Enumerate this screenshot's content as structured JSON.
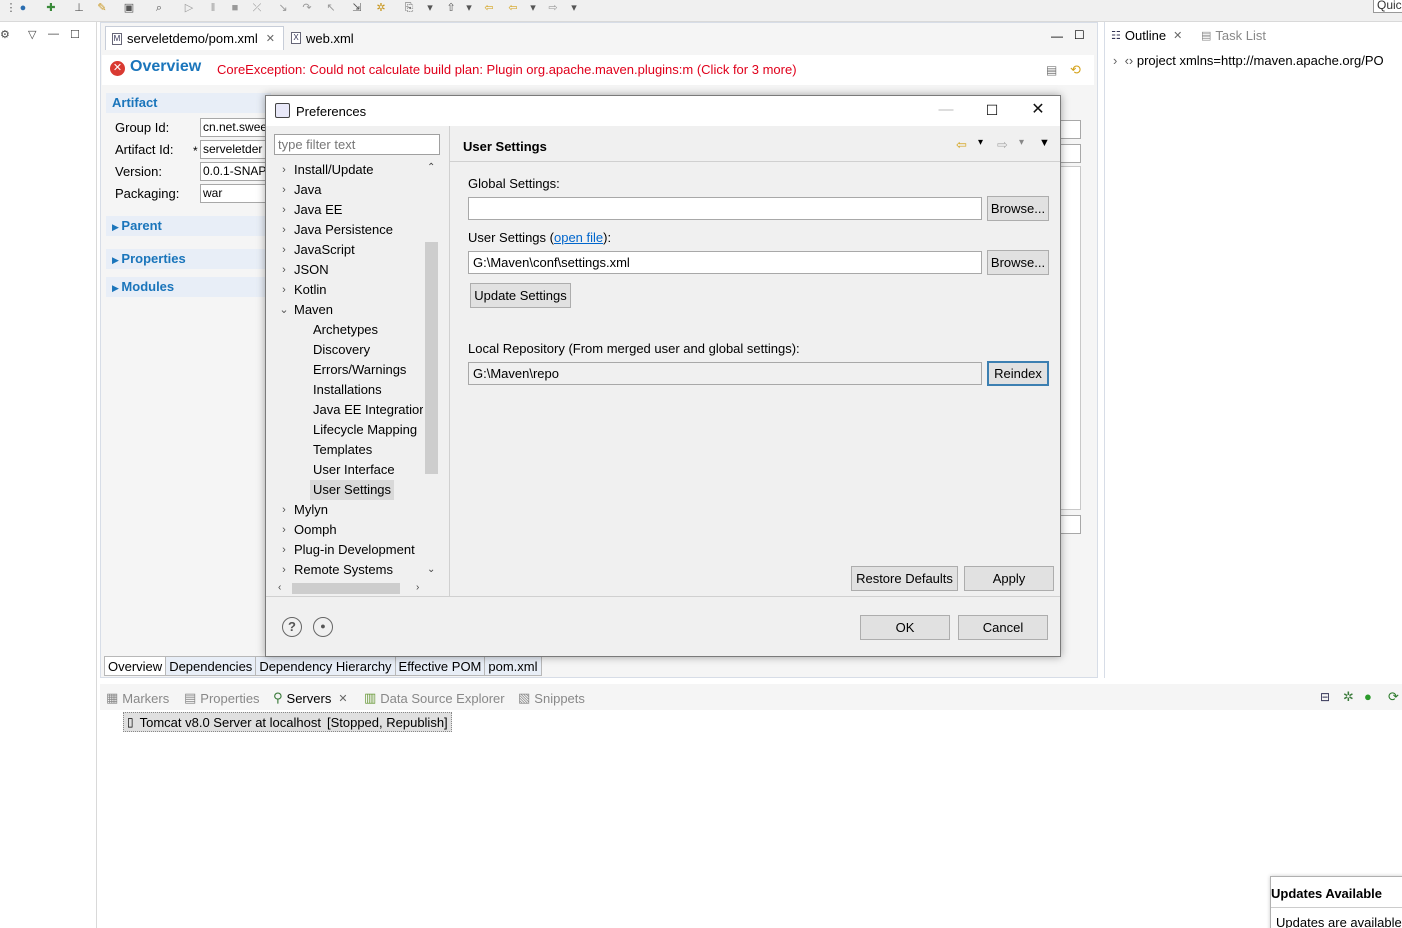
{
  "toolbar": {
    "quick_access": "Quic"
  },
  "editor": {
    "tabs": [
      {
        "label": "serveletdemo/pom.xml",
        "icon": "M"
      },
      {
        "label": "web.xml",
        "icon": "X"
      }
    ],
    "overview": {
      "title": "Overview",
      "error": "CoreException: Could not calculate build plan: Plugin org.apache.maven.plugins:m (Click for 3 more)"
    },
    "artifact": {
      "heading": "Artifact",
      "group_id_label": "Group Id:",
      "group_id": "cn.net.swee",
      "artifact_id_label": "Artifact Id:",
      "artifact_marker": "*",
      "artifact_id": "serveletder",
      "version_label": "Version:",
      "version": "0.0.1-SNAP",
      "packaging_label": "Packaging:",
      "packaging": "war"
    },
    "sections": [
      "Parent",
      "Properties",
      "Modules"
    ],
    "bottom_tabs": [
      "Overview",
      "Dependencies",
      "Dependency Hierarchy",
      "Effective POM",
      "pom.xml"
    ]
  },
  "outline": {
    "tabs": [
      "Outline",
      "Task List"
    ],
    "node": "project xmlns=http://maven.apache.org/PO"
  },
  "servers_panel": {
    "tabs": [
      "Markers",
      "Properties",
      "Servers",
      "Data Source Explorer",
      "Snippets"
    ],
    "server": "Tomcat v8.0 Server at localhost",
    "server_state": "[Stopped, Republish]"
  },
  "updates": {
    "title": "Updates Available",
    "body": "Updates are available"
  },
  "dialog": {
    "title": "Preferences",
    "filter_placeholder": "type filter text",
    "tree": [
      {
        "label": "Install/Update",
        "arrow": "›",
        "level": 0
      },
      {
        "label": "Java",
        "arrow": "›",
        "level": 0
      },
      {
        "label": "Java EE",
        "arrow": "›",
        "level": 0
      },
      {
        "label": "Java Persistence",
        "arrow": "›",
        "level": 0
      },
      {
        "label": "JavaScript",
        "arrow": "›",
        "level": 0
      },
      {
        "label": "JSON",
        "arrow": "›",
        "level": 0
      },
      {
        "label": "Kotlin",
        "arrow": "›",
        "level": 0
      },
      {
        "label": "Maven",
        "arrow": "⌄",
        "level": 0
      },
      {
        "label": "Archetypes",
        "arrow": "",
        "level": 1
      },
      {
        "label": "Discovery",
        "arrow": "",
        "level": 1
      },
      {
        "label": "Errors/Warnings",
        "arrow": "",
        "level": 1
      },
      {
        "label": "Installations",
        "arrow": "",
        "level": 1
      },
      {
        "label": "Java EE Integratior",
        "arrow": "",
        "level": 1
      },
      {
        "label": "Lifecycle Mapping",
        "arrow": "",
        "level": 1
      },
      {
        "label": "Templates",
        "arrow": "",
        "level": 1
      },
      {
        "label": "User Interface",
        "arrow": "",
        "level": 1
      },
      {
        "label": "User Settings",
        "arrow": "",
        "level": 1,
        "selected": true
      },
      {
        "label": "Mylyn",
        "arrow": "›",
        "level": 0
      },
      {
        "label": "Oomph",
        "arrow": "›",
        "level": 0
      },
      {
        "label": "Plug-in Development",
        "arrow": "›",
        "level": 0
      },
      {
        "label": "Remote Systems",
        "arrow": "›",
        "level": 0
      }
    ],
    "page": {
      "title": "User Settings",
      "global_label": "Global Settings:",
      "global_value": "",
      "user_label_pre": "User Settings (",
      "user_link": "open file",
      "user_label_post": "):",
      "user_value": "G:\\Maven\\conf\\settings.xml",
      "update_button": "Update Settings",
      "local_repo_label": "Local Repository (From merged user and global settings):",
      "local_repo_value": "G:\\Maven\\repo",
      "browse": "Browse...",
      "reindex": "Reindex",
      "restore_defaults": "Restore Defaults",
      "apply": "Apply"
    },
    "ok": "OK",
    "cancel": "Cancel"
  }
}
